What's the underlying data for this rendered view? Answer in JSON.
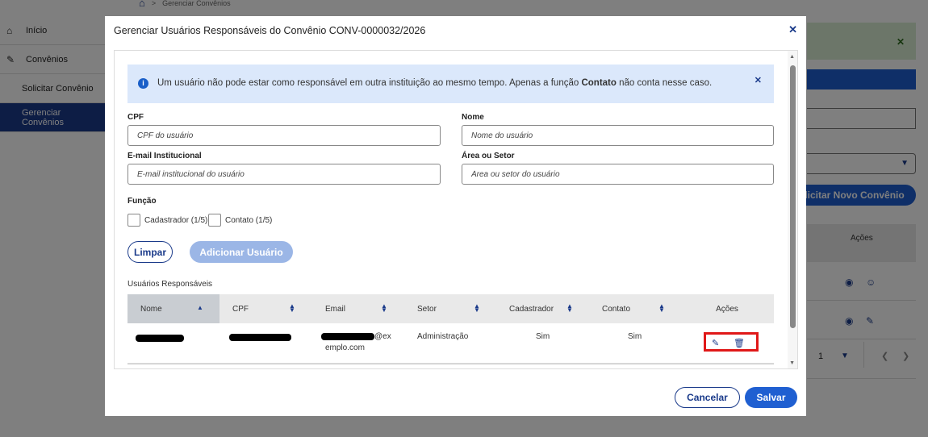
{
  "breadcrumb": {
    "home_icon": "home-icon",
    "current": "Gerenciar Convênios"
  },
  "sidebar": {
    "items": [
      {
        "label": "Início",
        "icon": "home-icon"
      },
      {
        "label": "Convênios",
        "icon": "document-edit-icon"
      },
      {
        "label": "Solicitar Convênio"
      },
      {
        "label": "Gerenciar Convênios",
        "active": true
      }
    ]
  },
  "background": {
    "new_button_label": "olicitar Novo Convênio",
    "actions_header": "Ações",
    "page_number": "1"
  },
  "modal": {
    "title": "Gerenciar Usuários Responsáveis do Convênio CONV-0000032/2026",
    "info_text_before": "Um usuário não pode estar como responsável em outra instituição ao mesmo tempo. Apenas a função ",
    "info_text_bold": "Contato",
    "info_text_after": " não conta nesse caso.",
    "fields": {
      "cpf_label": "CPF",
      "cpf_placeholder": "CPF do usuário",
      "nome_label": "Nome",
      "nome_placeholder": "Nome do usuário",
      "email_label": "E-mail Institucional",
      "email_placeholder": "E-mail institucional do usuário",
      "area_label": "Área ou Setor",
      "area_placeholder": "Área ou setor do usuário"
    },
    "funcao": {
      "label": "Função",
      "options": [
        {
          "label": "Cadastrador (1/5)",
          "checked": false
        },
        {
          "label": "Contato (1/5)",
          "checked": false
        }
      ]
    },
    "buttons": {
      "limpar": "Limpar",
      "adicionar": "Adicionar Usuário",
      "cancelar": "Cancelar",
      "salvar": "Salvar"
    },
    "table": {
      "caption": "Usuários Responsáveis",
      "columns": [
        "Nome",
        "CPF",
        "Email",
        "Setor",
        "Cadastrador",
        "Contato",
        "Ações"
      ],
      "rows": [
        {
          "email_suffix": "@ex",
          "email_line2": "emplo.com",
          "setor": "Administração",
          "cadastrador": "Sim",
          "contato": "Sim"
        }
      ]
    }
  },
  "colors": {
    "primary": "#1f5fd1",
    "navy": "#1a3a8a",
    "info_bg": "#dbe8fb",
    "highlight": "#e01818"
  }
}
